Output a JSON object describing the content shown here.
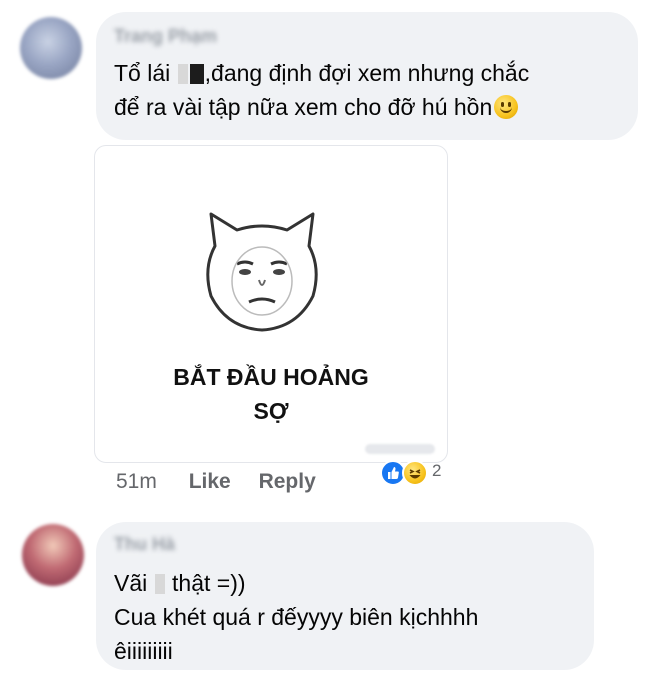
{
  "comments": [
    {
      "author": "Trang Phạm",
      "text_line1_prefix": "Tổ lái",
      "text_line1_suffix": ",đang định đợi xem nhưng chắc",
      "text_line2": "để ra vài tập nữa xem cho đỡ hú hồn",
      "emoji_icon": "slightly-smiling-face-icon"
    },
    {
      "author": "Thu Hà",
      "text_line1_prefix": "Vãi",
      "text_line1_suffix": "thật =))",
      "text_line2": "Cua khét quá r đếyyyy biên kịchhhh",
      "text_line3": "êiiiiiiiii"
    }
  ],
  "sticker": {
    "caption_line1": "BẮT ĐẦU HOẢNG",
    "caption_line2": "SỢ",
    "face_icon": "cat-face-sticker-icon"
  },
  "meta": {
    "time": "51m",
    "like_label": "Like",
    "reply_label": "Reply"
  },
  "reactions": {
    "icons": [
      "like-icon",
      "haha-icon"
    ],
    "count": "2",
    "like_color": "#1877f2"
  },
  "colors": {
    "bubble": "#f0f2f5",
    "meta_text": "#65676b"
  }
}
